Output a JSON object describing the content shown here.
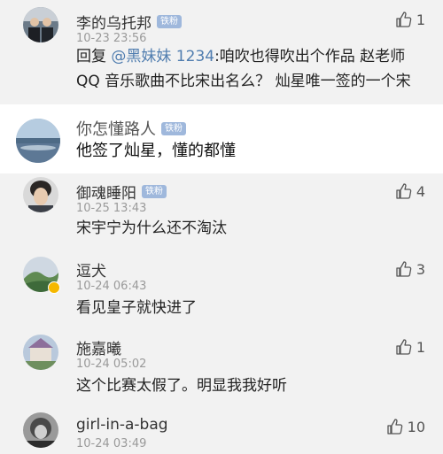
{
  "comments": [
    {
      "username": "李的乌托邦",
      "badge": "铁粉",
      "time": "10-23 23:56",
      "like_count": "1",
      "reply_prefix": "回复 ",
      "mention": "@黑妹妹 1234",
      "line1_rest": ":咱吹也得吹出个作品 赵老师",
      "line2": "QQ 音乐歌曲不比宋出名么？ 灿星唯一签的一个宋"
    },
    {
      "username": "御魂睡阳",
      "badge": "铁粉",
      "time": "10-25 13:43",
      "like_count": "4",
      "text": "宋宇宁为什么还不淘汰"
    },
    {
      "username": "逗犬",
      "time": "10-24 06:43",
      "like_count": "3",
      "text": "看见皇子就快进了"
    },
    {
      "username": "施嘉曦",
      "time": "10-24 05:02",
      "like_count": "1",
      "text": "这个比赛太假了。明显我我好听"
    },
    {
      "username": "girl-in-a-bag",
      "time": "10-24 03:49",
      "like_count": "10"
    }
  ],
  "overlay": {
    "username": "你怎懂路人",
    "badge": "铁粉",
    "text": "他签了灿星，懂的都懂"
  },
  "icons": {
    "like": "thumbs-up-icon",
    "verified": "verified-badge-icon"
  }
}
